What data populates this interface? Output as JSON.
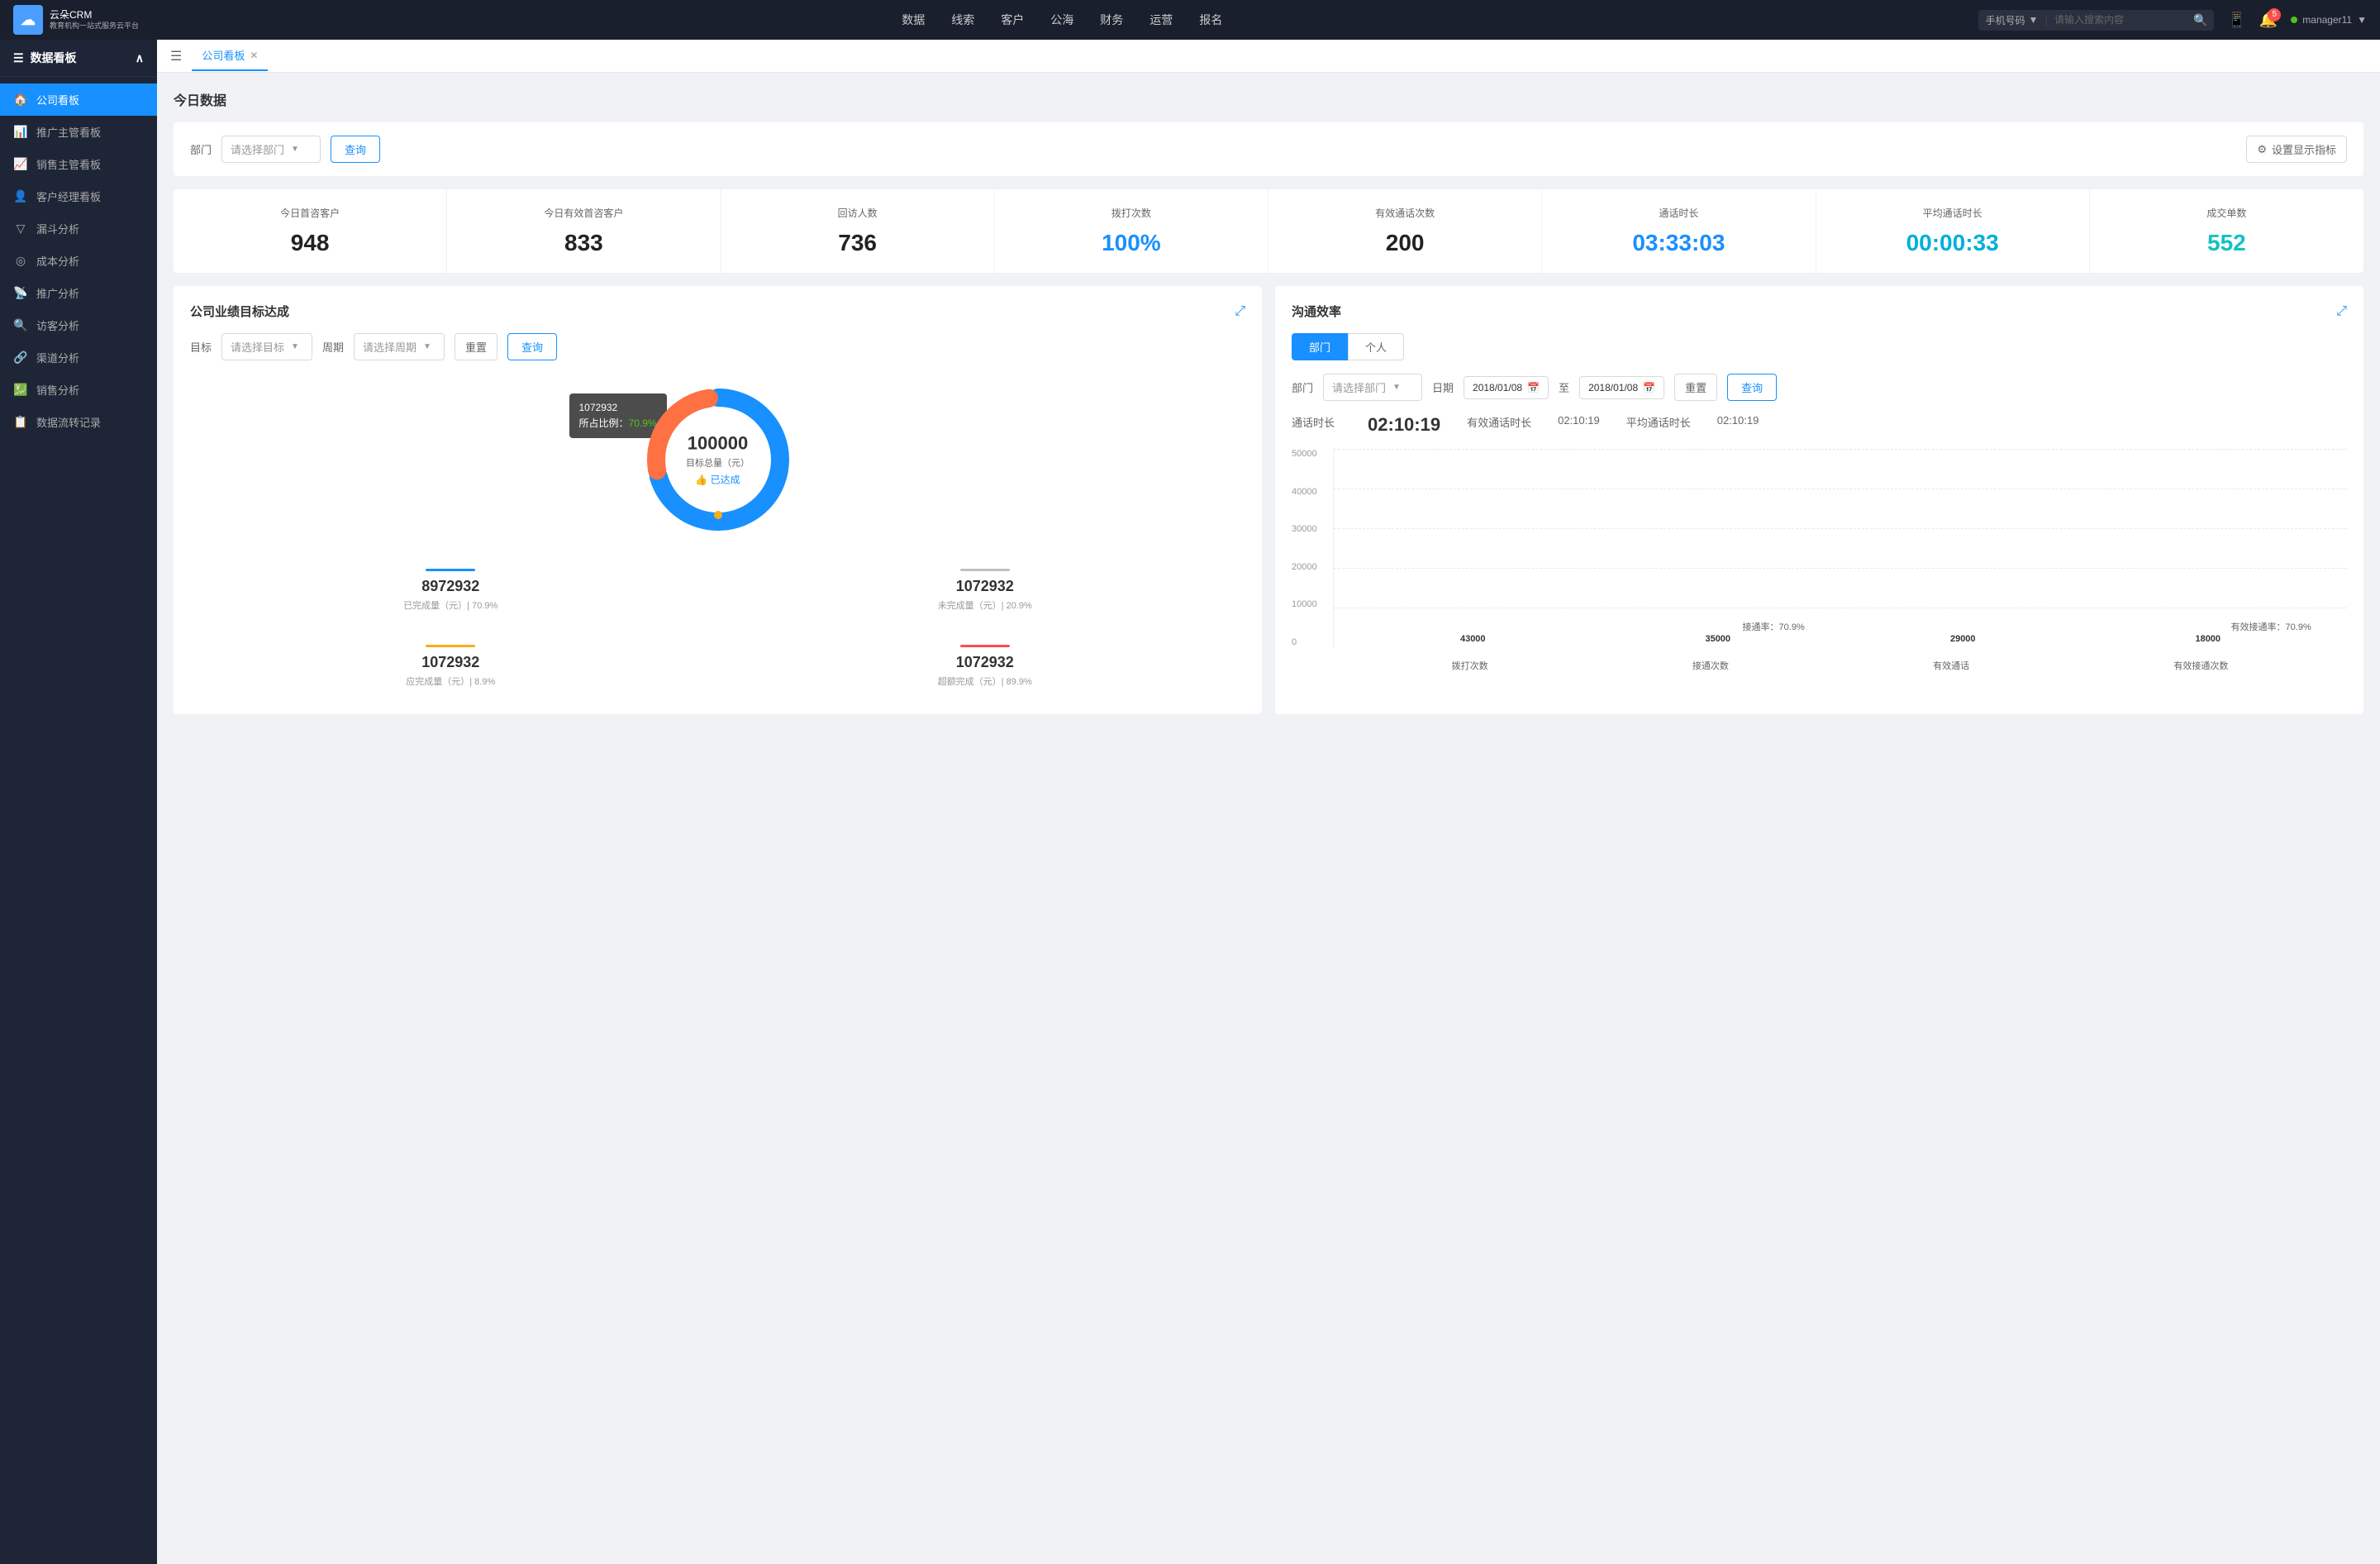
{
  "app": {
    "logo_line1": "云朵CRM",
    "logo_line2": "教育机构一站式服务云平台"
  },
  "top_nav": {
    "items": [
      "数据",
      "线索",
      "客户",
      "公海",
      "财务",
      "运营",
      "报名"
    ],
    "search_type": "手机号码",
    "search_placeholder": "请输入搜索内容",
    "notification_count": "5",
    "username": "manager11"
  },
  "sidebar": {
    "title": "数据看板",
    "items": [
      {
        "label": "公司看板",
        "active": true,
        "icon": "🏠"
      },
      {
        "label": "推广主管看板",
        "active": false,
        "icon": "📊"
      },
      {
        "label": "销售主管看板",
        "active": false,
        "icon": "📈"
      },
      {
        "label": "客户经理看板",
        "active": false,
        "icon": "👤"
      },
      {
        "label": "漏斗分析",
        "active": false,
        "icon": "▽"
      },
      {
        "label": "成本分析",
        "active": false,
        "icon": "◎"
      },
      {
        "label": "推广分析",
        "active": false,
        "icon": "📡"
      },
      {
        "label": "访客分析",
        "active": false,
        "icon": "🔍"
      },
      {
        "label": "渠道分析",
        "active": false,
        "icon": "🔗"
      },
      {
        "label": "销售分析",
        "active": false,
        "icon": "💹"
      },
      {
        "label": "数据流转记录",
        "active": false,
        "icon": "📋"
      }
    ]
  },
  "tab_bar": {
    "active_tab": "公司看板"
  },
  "page": {
    "today_data_title": "今日数据",
    "department_label": "部门",
    "department_placeholder": "请选择部门",
    "query_btn": "查询",
    "setting_btn": "设置显示指标"
  },
  "stats": [
    {
      "label": "今日首咨客户",
      "value": "948",
      "color": "dark"
    },
    {
      "label": "今日有效首咨客户",
      "value": "833",
      "color": "dark"
    },
    {
      "label": "回访人数",
      "value": "736",
      "color": "dark"
    },
    {
      "label": "拨打次数",
      "value": "100%",
      "color": "blue"
    },
    {
      "label": "有效通话次数",
      "value": "200",
      "color": "dark"
    },
    {
      "label": "通话时长",
      "value": "03:33:03",
      "color": "blue"
    },
    {
      "label": "平均通话时长",
      "value": "00:00:33",
      "color": "cyan"
    },
    {
      "label": "成交单数",
      "value": "552",
      "color": "teal"
    }
  ],
  "target_card": {
    "title": "公司业绩目标达成",
    "target_label": "目标",
    "target_placeholder": "请选择目标",
    "period_label": "周期",
    "period_placeholder": "请选择周期",
    "reset_btn": "重置",
    "query_btn": "查询",
    "donut": {
      "value": "100000",
      "label": "目标总量（元）",
      "achieved": "👍 已达成",
      "tooltip_value": "1072932",
      "tooltip_percent": "70.9%",
      "tooltip_label": "所占比例："
    },
    "stats": [
      {
        "color": "#1890ff",
        "value": "8972932",
        "label": "已完成量（元）| 70.9%"
      },
      {
        "color": "#c0c0c0",
        "value": "1072932",
        "label": "未完成量（元）| 20.9%"
      },
      {
        "color": "#faad14",
        "value": "1072932",
        "label": "应完成量（元）| 8.9%"
      },
      {
        "color": "#ff4d4f",
        "value": "1072932",
        "label": "超额完成（元）| 89.9%"
      }
    ]
  },
  "comm_card": {
    "title": "沟通效率",
    "dept_tab": "部门",
    "personal_tab": "个人",
    "dept_label": "部门",
    "dept_placeholder": "请选择部门",
    "date_label": "日期",
    "date_from": "2018/01/08",
    "date_to": "2018/01/08",
    "date_sep": "至",
    "reset_btn": "重置",
    "query_btn": "查询",
    "call_duration_label": "通话时长",
    "call_duration_value": "02:10:19",
    "effective_label": "有效通话时长",
    "effective_value": "02:10:19",
    "avg_label": "平均通话时长",
    "avg_value": "02:10:19",
    "chart": {
      "y_labels": [
        "50000",
        "40000",
        "30000",
        "20000",
        "10000",
        "0"
      ],
      "bars": [
        {
          "category": "拨打次数",
          "main_value": 43000,
          "secondary_value": null,
          "annotation": null
        },
        {
          "category": "接通次数",
          "main_value": 35000,
          "secondary_value": null,
          "annotation": "接通率：70.9%"
        },
        {
          "category": "有效通话",
          "main_value": 29000,
          "secondary_value": null,
          "annotation": null
        },
        {
          "category": "有效接通次数",
          "main_value": 18000,
          "secondary_value": null,
          "annotation": "有效接通率：70.9%"
        }
      ],
      "bar_labels": [
        "43000",
        "35000",
        "29000",
        "18000"
      ]
    }
  }
}
